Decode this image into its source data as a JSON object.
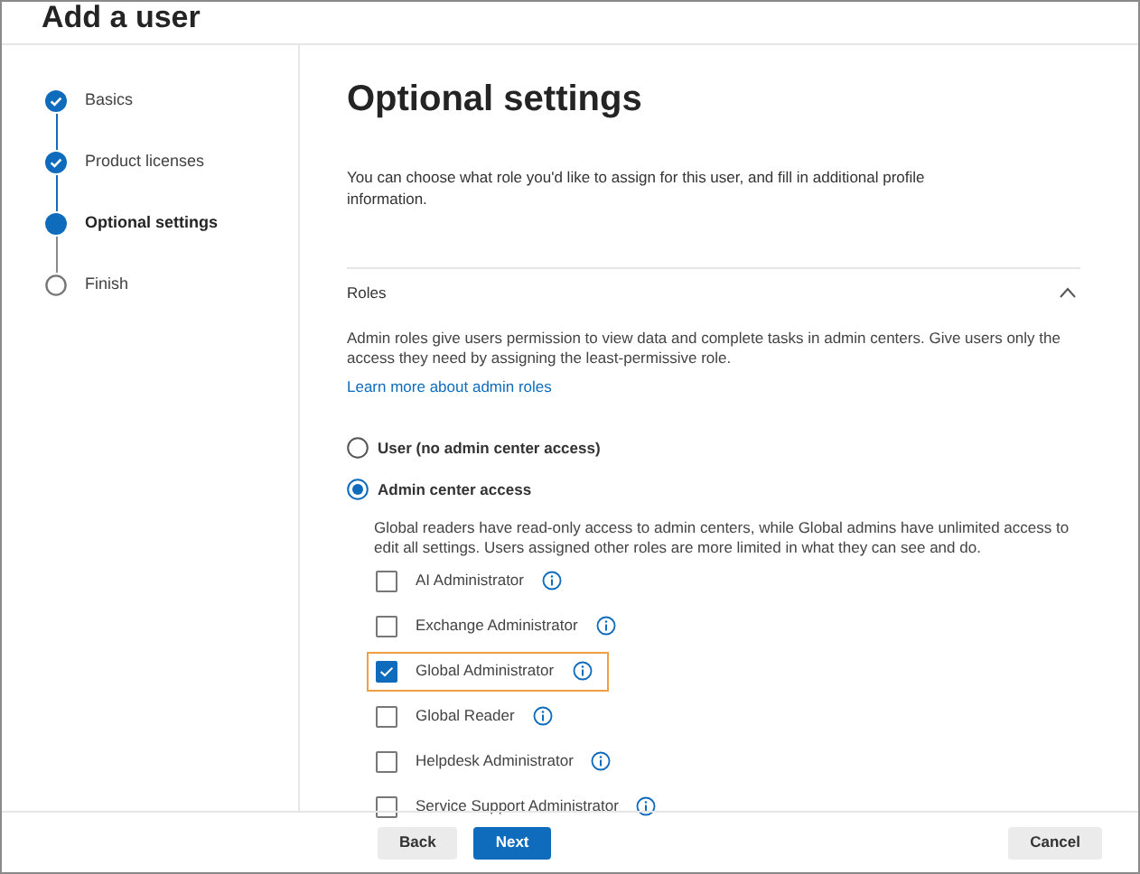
{
  "window": {
    "title": "Add a user"
  },
  "steps": [
    {
      "label": "Basics",
      "kind": "done"
    },
    {
      "label": "Product licenses",
      "kind": "done"
    },
    {
      "label": "Optional settings",
      "kind": "current"
    },
    {
      "label": "Finish",
      "kind": "pending"
    }
  ],
  "heading": "Optional settings",
  "intro": "You can choose what role you'd like to assign for this user, and fill in additional profile information.",
  "roles": {
    "title": "Roles",
    "expanded": true,
    "description": "Admin roles give users permission to view data and complete tasks in admin centers. Give users only the access they need by assigning the least-permissive role.",
    "link": "Learn more about admin roles",
    "options": [
      {
        "label": "User (no admin center access)",
        "selected": false
      },
      {
        "label": "Admin center access",
        "selected": true
      }
    ],
    "access_note": "Global readers have read-only access to admin centers, while Global admins have unlimited access to edit all settings. Users assigned other roles are more limited in what they can see and do.",
    "role_list": [
      {
        "label": "AI Administrator",
        "checked": false,
        "highlighted": false
      },
      {
        "label": "Exchange Administrator",
        "checked": false,
        "highlighted": false
      },
      {
        "label": "Global Administrator",
        "checked": true,
        "highlighted": true
      },
      {
        "label": "Global Reader",
        "checked": false,
        "highlighted": false
      },
      {
        "label": "Helpdesk Administrator",
        "checked": false,
        "highlighted": false
      },
      {
        "label": "Service Support Administrator",
        "checked": false,
        "highlighted": false
      }
    ]
  },
  "buttons": [
    {
      "label": "Back",
      "kind": "secondary"
    },
    {
      "label": "Next",
      "kind": "primary"
    },
    {
      "label": "Cancel",
      "kind": "secondary"
    }
  ]
}
